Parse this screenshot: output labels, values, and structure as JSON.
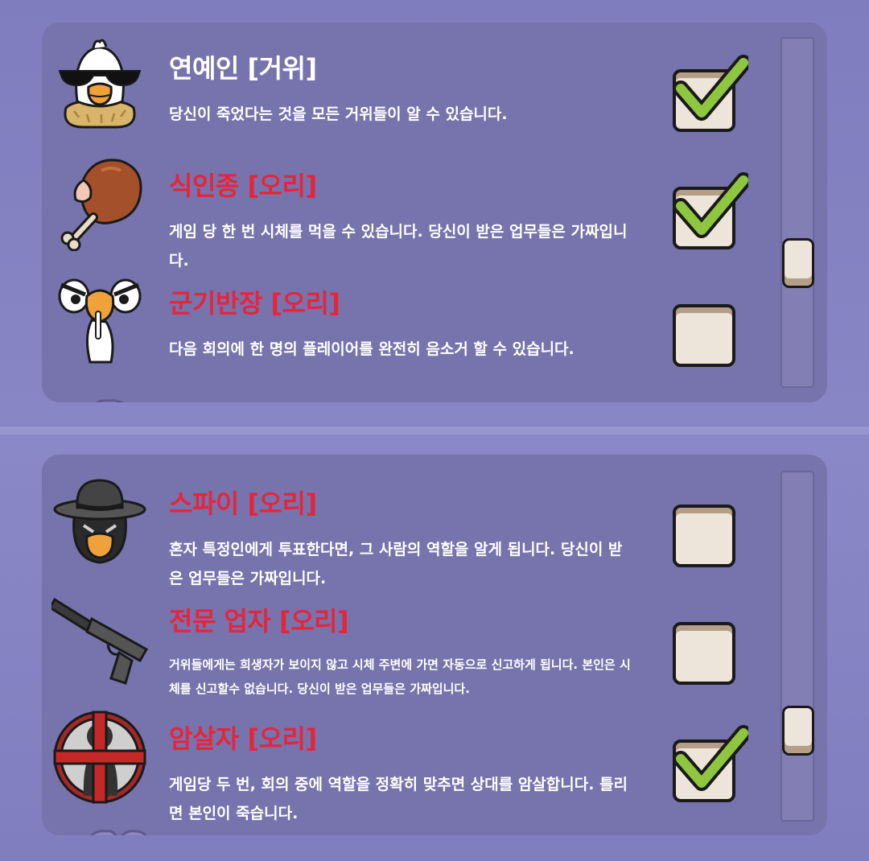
{
  "panels": [
    {
      "roles": [
        {
          "title": "연예인 [거위]",
          "team": "goose",
          "description": "당신이 죽었다는 것을 모든 거위들이 알 수 있습니다.",
          "icon": "celebrity-goose-icon",
          "enabled": true
        },
        {
          "title": "식인종 [오리]",
          "team": "duck",
          "description": "게임 당 한 번 시체를 먹을 수 있습니다. 당신이 받은 업무들은 가짜입니다.",
          "icon": "drumstick-icon",
          "enabled": true
        },
        {
          "title": "군기반장 [오리]",
          "team": "duck",
          "description": "다음 회의에 한 명의 플레이어를 완전히 음소거 할 수 있습니다.",
          "icon": "shushing-duck-icon",
          "enabled": false
        }
      ],
      "scroll_position": 0.62
    },
    {
      "roles": [
        {
          "title": "스파이 [오리]",
          "team": "duck",
          "description": "혼자 특정인에게 투표한다면, 그 사람의 역할을 알게 됩니다. 당신이 받은 업무들은 가짜입니다.",
          "icon": "spy-duck-icon",
          "enabled": false
        },
        {
          "title": "전문 업자 [오리]",
          "team": "duck",
          "description": "거위들에게는 희생자가 보이지 않고 시체 주변에 가면 자동으로 신고하게 됩니다. 본인은 시체를 신고할수 없습니다. 당신이 받은 업무들은 가짜입니다.",
          "icon": "silenced-pistol-icon",
          "enabled": false
        },
        {
          "title": "암살자 [오리]",
          "team": "duck",
          "description": "게임당 두 번, 회의 중에 역할을 정확히 맞추면 상대를 암살합니다. 틀리면 본인이 죽습니다.",
          "icon": "crosshair-icon",
          "enabled": true
        }
      ],
      "scroll_position": 0.72
    }
  ],
  "colors": {
    "goose_title": "#ffffff",
    "duck_title": "#e8243a",
    "panel": "#7673ad",
    "checkbox_fill": "#ede4da",
    "check_mark": "#8ec63f"
  }
}
